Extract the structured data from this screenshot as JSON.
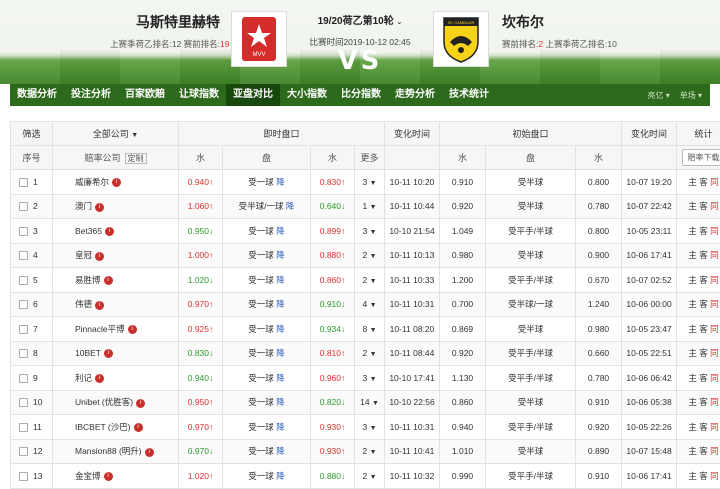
{
  "match": {
    "home_team": "马斯特里赫特",
    "home_info_prefix": "上赛季荷乙排名:12  赛前排名:",
    "home_rank": "19",
    "away_team": "坎布尔",
    "away_info_prefix": "赛前排名:",
    "away_rank": "2",
    "away_info_suffix": "上赛季荷乙排名:10",
    "title": "19/20荷乙第10轮",
    "time": "比赛时间2019-10-12 02:45",
    "vs": "VS",
    "home_logo_text": "MVV",
    "away_logo_text": "SC CAMBUUR"
  },
  "nav": {
    "items": [
      "数据分析",
      "投注分析",
      "百家欧赔",
      "让球指数",
      "亚盘对比",
      "大小指数",
      "比分指数",
      "走势分析",
      "技术统计"
    ],
    "active": "亚盘对比",
    "right1": "亮亿 ▾",
    "right2": "单场 ▾"
  },
  "table": {
    "h_filter": "筛选",
    "h_all": "全部公司",
    "h_live": "即时盘口",
    "h_change": "变化时间",
    "h_init": "初始盘口",
    "h_change2": "变化时间",
    "h_stats": "统计",
    "h_no": "序号",
    "h_company": "赔率公司",
    "h_custom": "定制",
    "h_water1": "水",
    "h_pan1": "盘",
    "h_water2": "水",
    "h_more": "更多",
    "h_water3": "水",
    "h_pan2": "盘",
    "h_water4": "水",
    "h_download": "赔率下载",
    "down_word": "降",
    "link_zhu": "主",
    "link_ke": "客",
    "link_tong": "同",
    "rows": [
      {
        "no": "1",
        "company": "威廉希尔",
        "w1": "0.940↑",
        "w1c": "up",
        "pan": "受一球",
        "w2": "0.830↑",
        "w2c": "up",
        "more": "3",
        "t1": "10-11 10:20",
        "iw1": "0.910",
        "ipan": "受半球",
        "iw2": "0.800",
        "t2": "10-07 19:20"
      },
      {
        "no": "2",
        "company": "澳门",
        "w1": "1.060↑",
        "w1c": "up",
        "pan": "受半球/一球",
        "w2": "0.640↓",
        "w2c": "down",
        "more": "1",
        "t1": "10-11 10:44",
        "iw1": "0.920",
        "ipan": "受半球",
        "iw2": "0.780",
        "t2": "10-07 22:42"
      },
      {
        "no": "3",
        "company": "Bet365",
        "w1": "0.950↓",
        "w1c": "down",
        "pan": "受一球",
        "w2": "0.899↑",
        "w2c": "up",
        "more": "3",
        "t1": "10-10 21:54",
        "iw1": "1.049",
        "ipan": "受平手/半球",
        "iw2": "0.800",
        "t2": "10-05 23:11"
      },
      {
        "no": "4",
        "company": "皇冠",
        "w1": "1.000↑",
        "w1c": "up",
        "pan": "受一球",
        "w2": "0.880↑",
        "w2c": "up",
        "more": "2",
        "t1": "10-11 10:13",
        "iw1": "0.980",
        "ipan": "受半球",
        "iw2": "0.900",
        "t2": "10-06 17:41"
      },
      {
        "no": "5",
        "company": "易胜博",
        "w1": "1.020↓",
        "w1c": "down",
        "pan": "受一球",
        "w2": "0.860↑",
        "w2c": "up",
        "more": "2",
        "t1": "10-11 10:33",
        "iw1": "1.200",
        "ipan": "受平手/半球",
        "iw2": "0.670",
        "t2": "10-07 02:52"
      },
      {
        "no": "6",
        "company": "伟德",
        "w1": "0.970↑",
        "w1c": "up",
        "pan": "受一球",
        "w2": "0.910↓",
        "w2c": "down",
        "more": "4",
        "t1": "10-11 10:31",
        "iw1": "0.700",
        "ipan": "受半球/一球",
        "iw2": "1.240",
        "t2": "10-06 00:00"
      },
      {
        "no": "7",
        "company": "Pinnacle平博",
        "w1": "0.925↑",
        "w1c": "up",
        "pan": "受一球",
        "w2": "0.934↓",
        "w2c": "down",
        "more": "8",
        "t1": "10-11 08:20",
        "iw1": "0.869",
        "ipan": "受半球",
        "iw2": "0.980",
        "t2": "10-05 23:47"
      },
      {
        "no": "8",
        "company": "10BET",
        "w1": "0.830↓",
        "w1c": "down",
        "pan": "受一球",
        "w2": "0.810↑",
        "w2c": "up",
        "more": "2",
        "t1": "10-11 08:44",
        "iw1": "0.920",
        "ipan": "受平手/半球",
        "iw2": "0.660",
        "t2": "10-05 22:51"
      },
      {
        "no": "9",
        "company": "利记",
        "w1": "0.940↓",
        "w1c": "down",
        "pan": "受一球",
        "w2": "0.960↑",
        "w2c": "up",
        "more": "3",
        "t1": "10-10 17:41",
        "iw1": "1.130",
        "ipan": "受平手/半球",
        "iw2": "0.780",
        "t2": "10-06 06:42"
      },
      {
        "no": "10",
        "company": "Unibet (优胜客)",
        "w1": "0.950↑",
        "w1c": "up",
        "pan": "受一球",
        "w2": "0.820↓",
        "w2c": "down",
        "more": "14",
        "t1": "10-10 22:56",
        "iw1": "0.860",
        "ipan": "受半球",
        "iw2": "0.910",
        "t2": "10-06 05:38"
      },
      {
        "no": "11",
        "company": "IBCBET (沙巴)",
        "w1": "0.970↑",
        "w1c": "up",
        "pan": "受一球",
        "w2": "0.930↑",
        "w2c": "up",
        "more": "3",
        "t1": "10-11 10:31",
        "iw1": "0.940",
        "ipan": "受平手/半球",
        "iw2": "0.920",
        "t2": "10-05 22:26"
      },
      {
        "no": "12",
        "company": "Mansion88 (明升)",
        "w1": "0.970↓",
        "w1c": "down",
        "pan": "受一球",
        "w2": "0.930↑",
        "w2c": "up",
        "more": "2",
        "t1": "10-11 10:41",
        "iw1": "1.010",
        "ipan": "受半球",
        "iw2": "0.890",
        "t2": "10-07 15:48"
      },
      {
        "no": "13",
        "company": "金宝博",
        "w1": "1.020↑",
        "w1c": "up",
        "pan": "受一球",
        "w2": "0.880↓",
        "w2c": "down",
        "more": "2",
        "t1": "10-11 10:32",
        "iw1": "0.990",
        "ipan": "受平手/半球",
        "iw2": "0.910",
        "t2": "10-06 17:41"
      }
    ]
  }
}
